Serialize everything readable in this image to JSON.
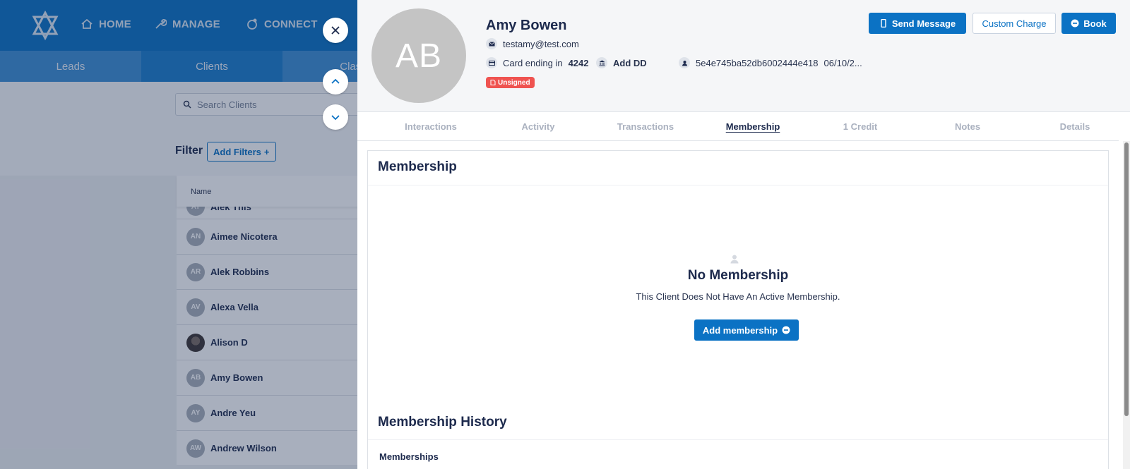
{
  "nav": {
    "home": "HOME",
    "manage": "MANAGE",
    "connect": "CONNECT"
  },
  "subnav": {
    "leads": "Leads",
    "clients": "Clients",
    "classes": "Class"
  },
  "search": {
    "placeholder": "Search Clients"
  },
  "filter": {
    "label": "Filter",
    "add_filters": "Add Filters"
  },
  "table": {
    "name_header": "Name",
    "rows": [
      {
        "initials": "AT",
        "name": "Alek This"
      },
      {
        "initials": "AN",
        "name": "Aimee Nicotera"
      },
      {
        "initials": "AR",
        "name": "Alek Robbins"
      },
      {
        "initials": "AV",
        "name": "Alexa Vella"
      },
      {
        "initials": "",
        "name": "Alison D"
      },
      {
        "initials": "AB",
        "name": "Amy Bowen"
      },
      {
        "initials": "AY",
        "name": "Andre Yeu"
      },
      {
        "initials": "AW",
        "name": "Andrew Wilson"
      }
    ]
  },
  "client": {
    "initials": "AB",
    "name": "Amy Bowen",
    "email": "testamy@test.com",
    "card_prefix": "Card ending in",
    "card_last4": "4242",
    "add_dd": "Add DD",
    "client_id": "5e4e745ba52db6002444e418",
    "date": "06/10/2...",
    "badge": "Unsigned"
  },
  "actions": {
    "send_message": "Send Message",
    "custom_charge": "Custom Charge",
    "book": "Book"
  },
  "tabs": [
    "Interactions",
    "Activity",
    "Transactions",
    "Membership",
    "1 Credit",
    "Notes",
    "Details"
  ],
  "membership": {
    "title": "Membership",
    "empty_title": "No Membership",
    "empty_sub": "This Client Does Not Have An Active Membership.",
    "add_button": "Add membership",
    "history_title": "Membership History",
    "history_sub": "Memberships"
  },
  "colors": {
    "primary": "#0b72c4",
    "badge": "#ef5350",
    "text": "#1d2a4d"
  }
}
